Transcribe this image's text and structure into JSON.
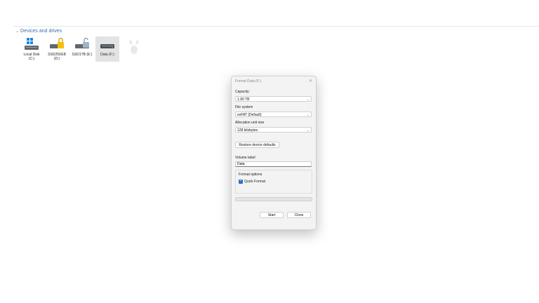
{
  "explorer": {
    "section_title": "Devices and drives",
    "drives": [
      {
        "label": "Local Disk\n(C:)",
        "icon": "windows-drive-icon"
      },
      {
        "label": "SSD250GB\n(D:)",
        "icon": "locked-drive-icon"
      },
      {
        "label": "SSD1TB (E:)",
        "icon": "unlocked-drive-icon"
      },
      {
        "label": "Data (F:)",
        "icon": "drive-icon",
        "selected": true
      }
    ]
  },
  "dialog": {
    "title": "Format Data (F:)",
    "capacity_label": "Capacity:",
    "capacity_value": "1.90 TB",
    "filesystem_label": "File system",
    "filesystem_value": "exFAT (Default)",
    "alloc_label": "Allocation unit size",
    "alloc_value": "128 kilobytes",
    "restore_button": "Restore device defaults",
    "volume_label": "Volume label",
    "volume_value": "Data",
    "options_title": "Format options",
    "quick_format_label": "Quick Format",
    "quick_format_checked": true,
    "progress": 0,
    "start_button": "Start",
    "close_button": "Close"
  },
  "colors": {
    "accent": "#2a6fc9",
    "header_link": "#3a6fb0"
  }
}
